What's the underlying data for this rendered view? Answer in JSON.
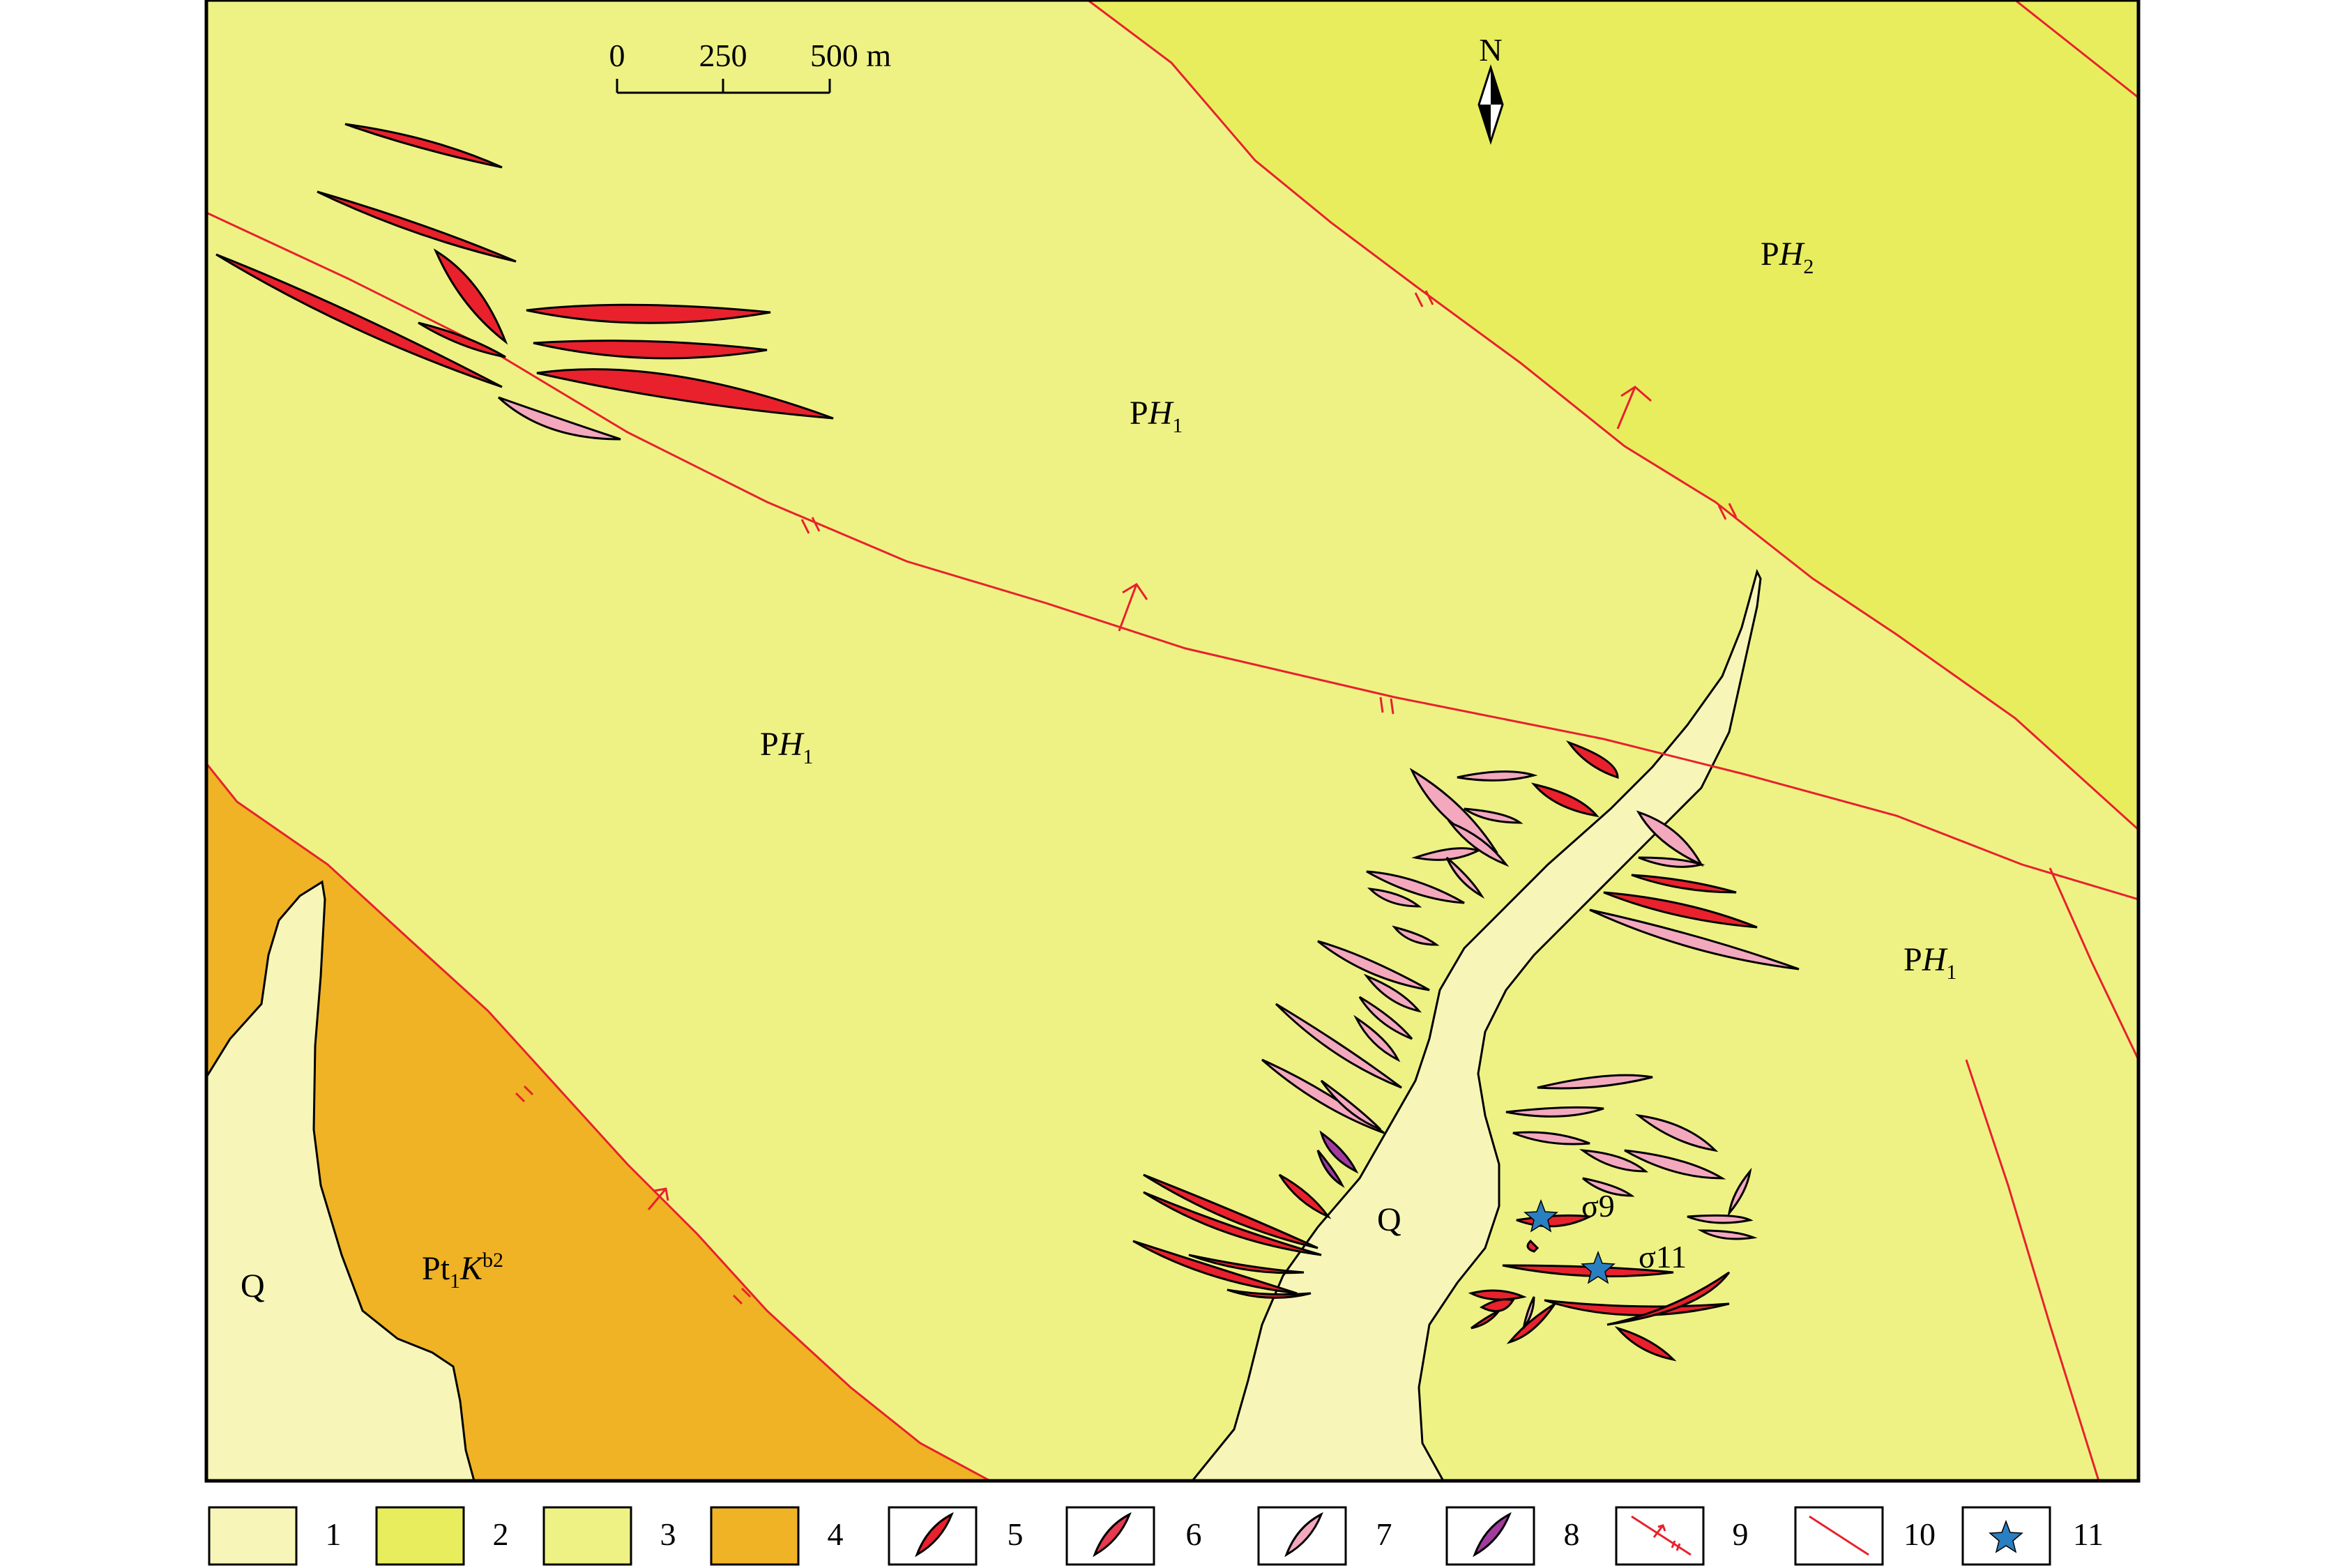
{
  "colors": {
    "Q": "#f7f6b8",
    "PH2": "#e8ed5e",
    "PH1": "#eef285",
    "Pt1Kb2": "#efb325",
    "vein_red": "#e8212c",
    "vein_crimson": "#e63950",
    "vein_pink": "#f4a8be",
    "vein_purple": "#a03c9e",
    "fault": "#e8212c",
    "star": "#2a7fc0"
  },
  "north": {
    "label": "N",
    "icon": "north-arrow-icon"
  },
  "scale": {
    "ticks": [
      "0",
      "250",
      "500 m"
    ]
  },
  "units": {
    "PH2": {
      "main": "P",
      "italic": "H",
      "sub": "2"
    },
    "PH1": {
      "main": "P",
      "italic": "H",
      "sub": "1"
    },
    "Pt1Kb2": {
      "main": "Pt",
      "sub": "1",
      "italic": "K",
      "sup": "b2"
    },
    "Q": "Q"
  },
  "samples": [
    "σ9",
    "σ11"
  ],
  "legend": [
    {
      "num": "1",
      "icon": "swatch-quaternary"
    },
    {
      "num": "2",
      "icon": "swatch-ph2"
    },
    {
      "num": "3",
      "icon": "swatch-ph1"
    },
    {
      "num": "4",
      "icon": "swatch-pt1kb2"
    },
    {
      "num": "5",
      "icon": "vein-red-icon"
    },
    {
      "num": "6",
      "icon": "vein-crimson-icon"
    },
    {
      "num": "7",
      "icon": "vein-pink-icon"
    },
    {
      "num": "8",
      "icon": "vein-purple-icon"
    },
    {
      "num": "9",
      "icon": "thrust-fault-icon"
    },
    {
      "num": "10",
      "icon": "fault-line-icon"
    },
    {
      "num": "11",
      "icon": "sample-star-icon"
    }
  ]
}
